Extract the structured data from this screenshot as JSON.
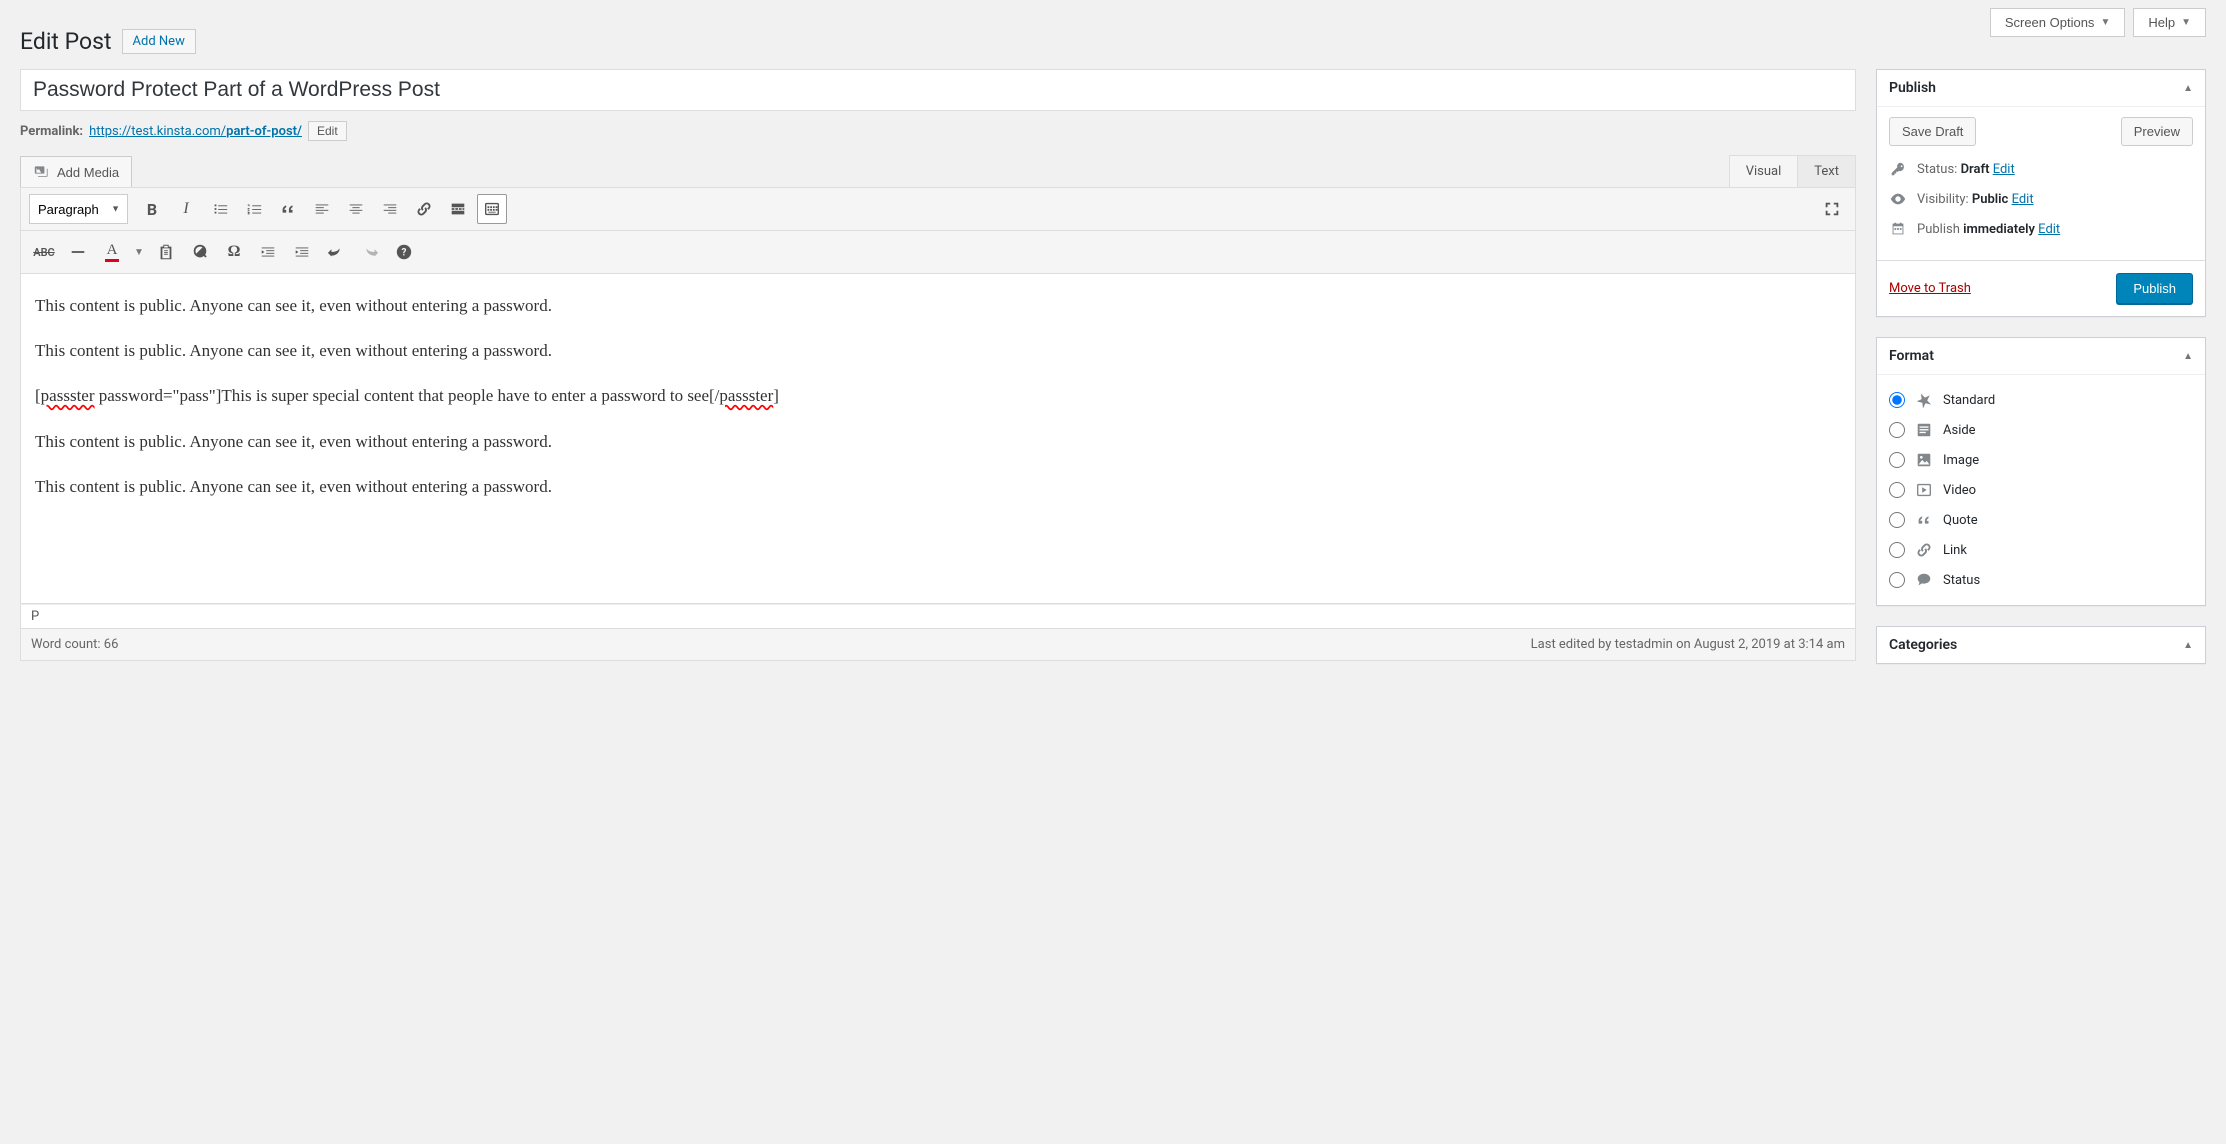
{
  "topbar": {
    "screen_options": "Screen Options",
    "help": "Help"
  },
  "header": {
    "page_title": "Edit Post",
    "add_new": "Add New"
  },
  "post": {
    "title": "Password Protect Part of a WordPress Post",
    "permalink_label": "Permalink:",
    "permalink_base": "https://test.kinsta.com/",
    "permalink_slug": "part-of-post/",
    "edit_btn": "Edit"
  },
  "editor": {
    "add_media": "Add Media",
    "tab_visual": "Visual",
    "tab_text": "Text",
    "format_select": "Paragraph",
    "content_p1": "This content is public. Anyone can see it, even without entering a password.",
    "content_p2": "This content is public. Anyone can see it, even without entering a password.",
    "content_p3_open_tag": "passster",
    "content_p3_attrs": " password=\"pass\"]This is super special content that people have to enter a password to see[/",
    "content_p3_close_tag": "passster",
    "content_p3_end": "]",
    "content_p4": "This content is public. Anyone can see it, even without entering a password.",
    "content_p5": "This content is public. Anyone can see it, even without entering a password.",
    "path": "P",
    "word_count_label": "Word count: ",
    "word_count": "66",
    "last_edited": "Last edited by testadmin on August 2, 2019 at 3:14 am"
  },
  "publish": {
    "title": "Publish",
    "save_draft": "Save Draft",
    "preview": "Preview",
    "status_label": "Status:",
    "status_value": "Draft",
    "visibility_label": "Visibility:",
    "visibility_value": "Public",
    "schedule_label": "Publish",
    "schedule_value": "immediately",
    "edit": "Edit",
    "trash": "Move to Trash",
    "publish_btn": "Publish"
  },
  "format": {
    "title": "Format",
    "items": [
      {
        "label": "Standard",
        "checked": true
      },
      {
        "label": "Aside",
        "checked": false
      },
      {
        "label": "Image",
        "checked": false
      },
      {
        "label": "Video",
        "checked": false
      },
      {
        "label": "Quote",
        "checked": false
      },
      {
        "label": "Link",
        "checked": false
      },
      {
        "label": "Status",
        "checked": false
      }
    ]
  },
  "categories": {
    "title": "Categories"
  }
}
